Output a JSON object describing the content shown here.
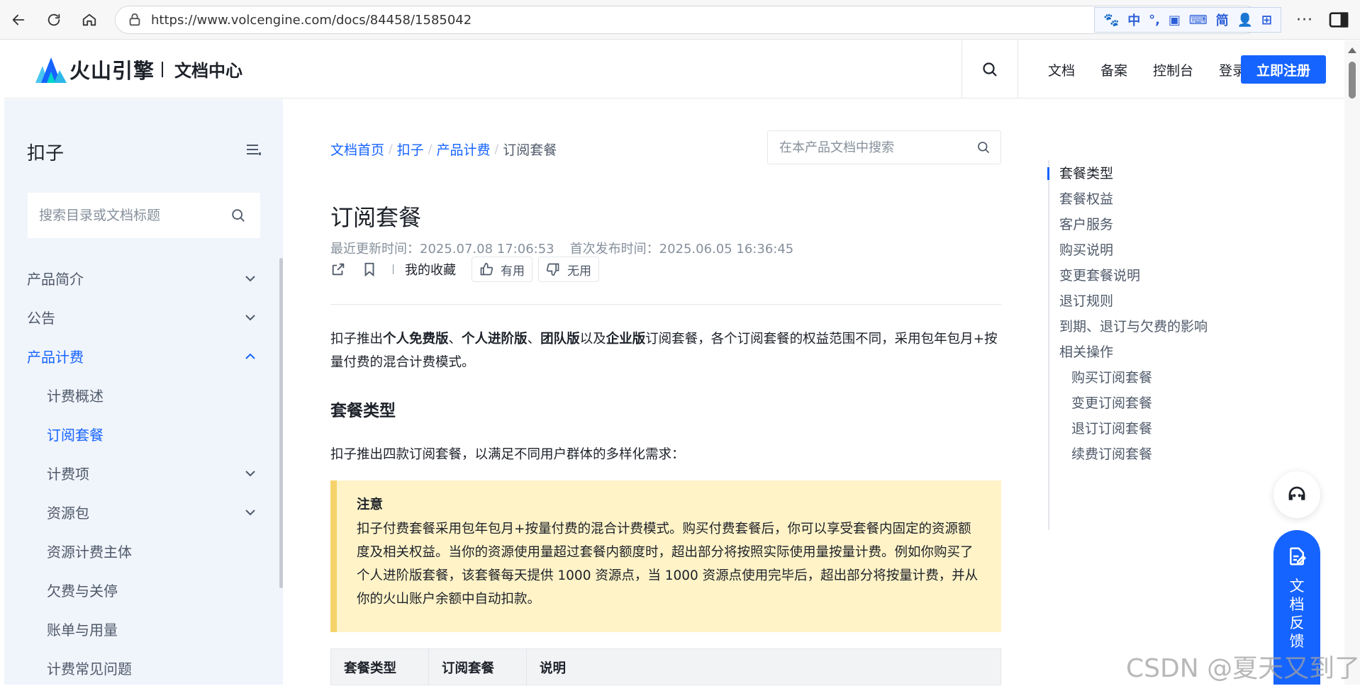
{
  "browser": {
    "url": "https://www.volcengine.com/docs/84458/1585042",
    "ime": [
      "🐾",
      "中",
      "°,",
      "▣",
      "⌨",
      "简",
      "👤",
      "⊞"
    ],
    "more": "···"
  },
  "header": {
    "brand": "火山引擎",
    "subtitle": "文档中心",
    "links": [
      "文档",
      "备案",
      "控制台",
      "登录"
    ],
    "signup": "立即注册"
  },
  "sidebar": {
    "title": "扣子",
    "search_placeholder": "搜索目录或文档标题",
    "items": [
      {
        "label": "产品简介",
        "level": 1,
        "chevron": "down",
        "active": false
      },
      {
        "label": "公告",
        "level": 1,
        "chevron": "down",
        "active": false
      },
      {
        "label": "产品计费",
        "level": 1,
        "chevron": "up",
        "active": true
      },
      {
        "label": "计费概述",
        "level": 2,
        "chevron": "",
        "active": false
      },
      {
        "label": "订阅套餐",
        "level": 2,
        "chevron": "",
        "active": true
      },
      {
        "label": "计费项",
        "level": 2,
        "chevron": "down",
        "active": false
      },
      {
        "label": "资源包",
        "level": 2,
        "chevron": "down",
        "active": false
      },
      {
        "label": "资源计费主体",
        "level": 2,
        "chevron": "",
        "active": false
      },
      {
        "label": "欠费与关停",
        "level": 2,
        "chevron": "",
        "active": false
      },
      {
        "label": "账单与用量",
        "level": 2,
        "chevron": "",
        "active": false
      },
      {
        "label": "计费常见问题",
        "level": 2,
        "chevron": "",
        "active": false
      }
    ]
  },
  "main": {
    "breadcrumb": [
      "文档首页",
      "扣子",
      "产品计费",
      "订阅套餐"
    ],
    "search_placeholder": "在本产品文档中搜索",
    "title": "订阅套餐",
    "updated": "最近更新时间：2025.07.08 17:06:53",
    "published": "首次发布时间：2025.06.05 16:36:45",
    "favorites": "我的收藏",
    "useful": "有用",
    "useless": "无用",
    "intro": {
      "p1": "扣子推出",
      "b1": "个人免费版",
      "p2": "、",
      "b2": "个人进阶版",
      "p3": "、",
      "b3": "团队版",
      "p4": "以及",
      "b4": "企业版",
      "p5": "订阅套餐，各个订阅套餐的权益范围不同，采用包年包月+按量付费的混合计费模式。"
    },
    "section_title": "套餐类型",
    "section_text": "扣子推出四款订阅套餐，以满足不同用户群体的多样化需求：",
    "notice_title": "注意",
    "notice_body": "扣子付费套餐采用包年包月+按量付费的混合计费模式。购买付费套餐后，你可以享受套餐内固定的资源额度及相关权益。当你的资源使用量超过套餐内额度时，超出部分将按照实际使用量按量计费。例如你购买了个人进阶版套餐，该套餐每天提供 1000 资源点，当 1000 资源点使用完毕后，超出部分将按量计费，并从你的火山账户余额中自动扣款。",
    "table_headers": [
      "套餐类型",
      "订阅套餐",
      "说明"
    ]
  },
  "toc": {
    "items": [
      {
        "label": "套餐类型",
        "level": 1,
        "active": true
      },
      {
        "label": "套餐权益",
        "level": 1,
        "active": false
      },
      {
        "label": "客户服务",
        "level": 1,
        "active": false
      },
      {
        "label": "购买说明",
        "level": 1,
        "active": false
      },
      {
        "label": "变更套餐说明",
        "level": 1,
        "active": false
      },
      {
        "label": "退订规则",
        "level": 1,
        "active": false
      },
      {
        "label": "到期、退订与欠费的影响",
        "level": 1,
        "active": false
      },
      {
        "label": "相关操作",
        "level": 1,
        "active": false
      },
      {
        "label": "购买订阅套餐",
        "level": 2,
        "active": false
      },
      {
        "label": "变更订阅套餐",
        "level": 2,
        "active": false
      },
      {
        "label": "退订订阅套餐",
        "level": 2,
        "active": false
      },
      {
        "label": "续费订阅套餐",
        "level": 2,
        "active": false
      }
    ]
  },
  "floating": {
    "feedback": "文档反馈"
  },
  "watermark": "CSDN @夏天又到了",
  "colors": {
    "accent": "#1664ff",
    "sidebar_bg": "#f0f4fb",
    "notice_bg": "#fff3c7",
    "notice_border": "#f5d36a"
  }
}
